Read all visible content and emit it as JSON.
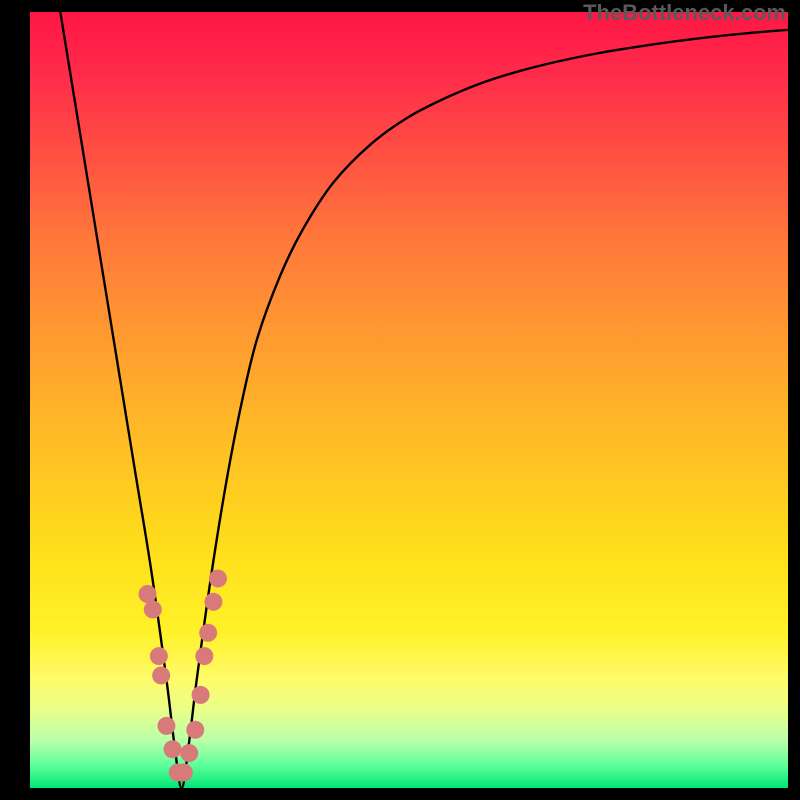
{
  "watermark": "TheBottleneck.com",
  "chart_data": {
    "type": "line",
    "title": "",
    "xlabel": "",
    "ylabel": "",
    "xlim": [
      0,
      100
    ],
    "ylim": [
      0,
      100
    ],
    "gradient": {
      "description": "vertical gradient background red to yellow to green",
      "stops": [
        {
          "offset": 0,
          "color": "#ff1744"
        },
        {
          "offset": 0.08,
          "color": "#ff2b4a"
        },
        {
          "offset": 0.3,
          "color": "#ff7a3a"
        },
        {
          "offset": 0.5,
          "color": "#ffb02a"
        },
        {
          "offset": 0.7,
          "color": "#ffe01a"
        },
        {
          "offset": 0.8,
          "color": "#fff22a"
        },
        {
          "offset": 0.86,
          "color": "#fffb6a"
        },
        {
          "offset": 0.9,
          "color": "#e8ff8a"
        },
        {
          "offset": 0.94,
          "color": "#b8ffaa"
        },
        {
          "offset": 0.97,
          "color": "#60ff9a"
        },
        {
          "offset": 1.0,
          "color": "#00e676"
        }
      ]
    },
    "series": [
      {
        "name": "bottleneck-curve",
        "description": "V-shaped curve with minimum near x=20",
        "x": [
          4,
          6,
          8,
          10,
          12,
          14,
          16,
          18,
          19,
          20,
          21,
          22,
          24,
          26,
          28,
          30,
          33,
          36,
          40,
          45,
          50,
          55,
          60,
          65,
          70,
          75,
          80,
          85,
          90,
          95,
          100
        ],
        "y": [
          100,
          88,
          76,
          64,
          52,
          40,
          28,
          14,
          6,
          0,
          6,
          14,
          28,
          40,
          50,
          58,
          66,
          72,
          78,
          83,
          86.5,
          89,
          91,
          92.5,
          93.7,
          94.7,
          95.5,
          96.2,
          96.8,
          97.3,
          97.7
        ]
      }
    ],
    "markers": {
      "name": "data-point-markers",
      "color": "#d97a7a",
      "radius": 9,
      "points": [
        {
          "x": 15.5,
          "y": 25
        },
        {
          "x": 16.2,
          "y": 23
        },
        {
          "x": 17.0,
          "y": 17
        },
        {
          "x": 17.3,
          "y": 14.5
        },
        {
          "x": 18.0,
          "y": 8
        },
        {
          "x": 18.8,
          "y": 5
        },
        {
          "x": 19.5,
          "y": 2
        },
        {
          "x": 20.3,
          "y": 2
        },
        {
          "x": 21.0,
          "y": 4.5
        },
        {
          "x": 21.8,
          "y": 7.5
        },
        {
          "x": 22.5,
          "y": 12
        },
        {
          "x": 23.0,
          "y": 17
        },
        {
          "x": 23.5,
          "y": 20
        },
        {
          "x": 24.2,
          "y": 24
        },
        {
          "x": 24.8,
          "y": 27
        }
      ]
    }
  }
}
